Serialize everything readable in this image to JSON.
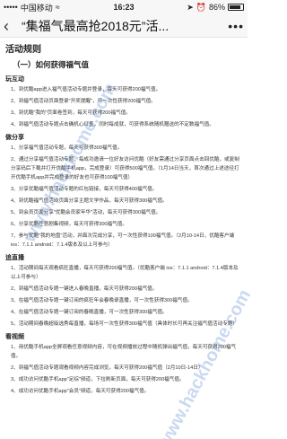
{
  "status_bar": {
    "carrier": "中国移动",
    "time": "16:23",
    "battery": "86%"
  },
  "nav": {
    "title": "“集福气最高抢2018元”活...",
    "back_icon": "chevron-left-icon",
    "more_icon": "more-icon"
  },
  "page": {
    "heading": "活动规则",
    "subheading": "（一）如何获得福气值",
    "sections": [
      {
        "title": "玩互动",
        "items": [
          "1、到优酷app进入福气值活动专题并登录，每天可获得200福气值。",
          "2、到福气值活动页面登录\"开奖提醒\"，可一次性获得200福气值。",
          "3、到优酷\"我的\"页面卷签到，每天可获得200福气值。",
          "4、到福气值活动专题点击确机心红盖，同时每成就，可获得系统随机赠送的不定数福气值。"
        ]
      },
      {
        "title": "做分享",
        "items": [
          "1、分享福气值活动专题，每天可获得300福气值。",
          "2、通过分享福气值活动专题，每成功邀请一位好友访问优酷（好友需通过分享页面点击回优酷，或复制分享码后下载并打开优酷手机app，完成登录）可获得500福气值。（1月14日当天，首次通过上述途径打开优酷手机app并完成登录的好友也可获得100福气值）",
          "3、分享优酷福气值活动专题的红包链接，每天可获得400福气值。",
          "4、到优酷福气值活动页面分享主题文学作品，每天可获得300福气值。",
          "5、到会员页面分享\"优酷会员家年华\"活动，每天可获得300福气值。",
          "6、分享优酷任意剧集视频，每天可获得300福气值。",
          "7、参与优酷\"我的地盘\"活动，并面次完成分享，可一次性获得100福气值。（2月10-14日，优酷客户端ios：7.1.1 android：7.1.4版本及以上可参与）"
        ]
      },
      {
        "title": "追直播",
        "items": [
          "1、活动期间每天观看疯狂直播，每天可获得200福气值。（优酷客户端 ios：7.1.1 android：7.1.4版本及以上可参与）",
          "2、到福气值活动专题一键进入春晚直播，每天可获得200福气值。",
          "3、在福气值活动专题一键订阅的疯狂年会春晚录直播，可一次性获得300福气值。",
          "4、在福气值活动专题一键订阅的春晚直播，可一次性获得300福气值。",
          "5、活动期间春晚超级选秀每直播，每场可一次性获得300福气值（具体时长可再关注福气值活动专题）"
        ]
      },
      {
        "title": "看视频",
        "items": [
          "1、用优酷手机app全屏观看任意视频内容，可在视频播放过程中随机弹出福气值，每天可获得200福气值。",
          "2、到福气值活动专题观看视频内容完成浏览，每天可获得200福气值（2月10日-14日）",
          "3、成功访问优酷手机app\"足综\"频道，下拉刷新页面，每天可获得200福气值。",
          "4、成功访问优酷手机app\"会员\"频道，每天可获得200福气值。"
        ]
      }
    ]
  },
  "watermark": {
    "text": "www.hackhome.com"
  }
}
